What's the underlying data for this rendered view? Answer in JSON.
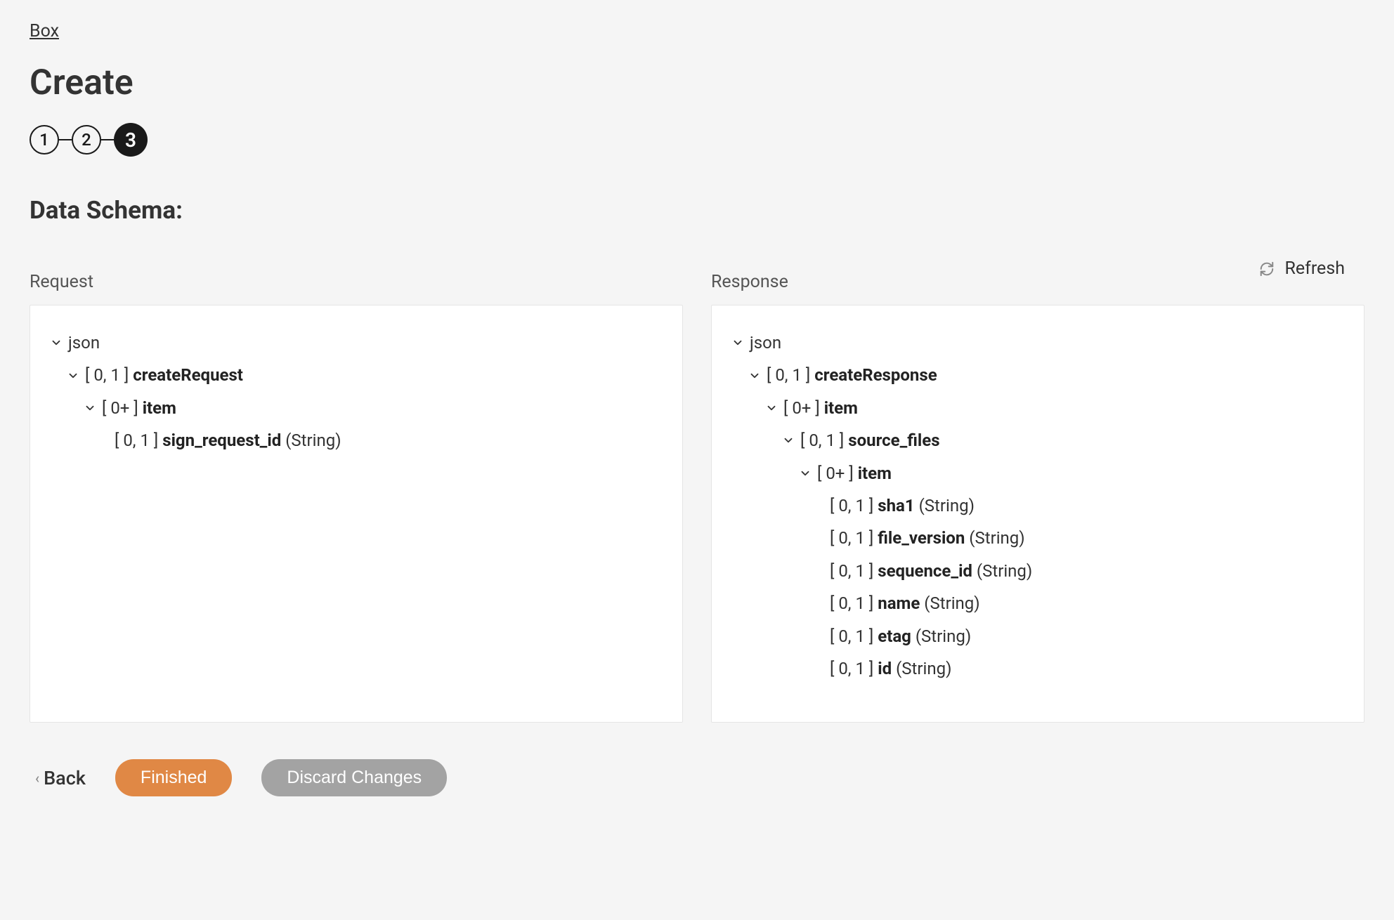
{
  "breadcrumb": "Box",
  "page_title": "Create",
  "stepper": {
    "steps": [
      "1",
      "2",
      "3"
    ],
    "active_index": 2
  },
  "section_title": "Data Schema:",
  "refresh_label": "Refresh",
  "panels": {
    "request": {
      "label": "Request",
      "root": "json",
      "tree": [
        {
          "cardinality": "[ 0, 1 ]",
          "name": "createRequest",
          "children": [
            {
              "cardinality": "[ 0+ ]",
              "name": "item",
              "children": [
                {
                  "cardinality": "[ 0, 1 ]",
                  "name": "sign_request_id",
                  "type": "(String)"
                }
              ]
            }
          ]
        }
      ]
    },
    "response": {
      "label": "Response",
      "root": "json",
      "tree": [
        {
          "cardinality": "[ 0, 1 ]",
          "name": "createResponse",
          "children": [
            {
              "cardinality": "[ 0+ ]",
              "name": "item",
              "children": [
                {
                  "cardinality": "[ 0, 1 ]",
                  "name": "source_files",
                  "children": [
                    {
                      "cardinality": "[ 0+ ]",
                      "name": "item",
                      "children": [
                        {
                          "cardinality": "[ 0, 1 ]",
                          "name": "sha1",
                          "type": "(String)"
                        },
                        {
                          "cardinality": "[ 0, 1 ]",
                          "name": "file_version",
                          "type": "(String)"
                        },
                        {
                          "cardinality": "[ 0, 1 ]",
                          "name": "sequence_id",
                          "type": "(String)"
                        },
                        {
                          "cardinality": "[ 0, 1 ]",
                          "name": "name",
                          "type": "(String)"
                        },
                        {
                          "cardinality": "[ 0, 1 ]",
                          "name": "etag",
                          "type": "(String)"
                        },
                        {
                          "cardinality": "[ 0, 1 ]",
                          "name": "id",
                          "type": "(String)"
                        }
                      ]
                    }
                  ]
                }
              ]
            }
          ]
        }
      ]
    }
  },
  "buttons": {
    "back": "Back",
    "finished": "Finished",
    "discard": "Discard Changes"
  }
}
